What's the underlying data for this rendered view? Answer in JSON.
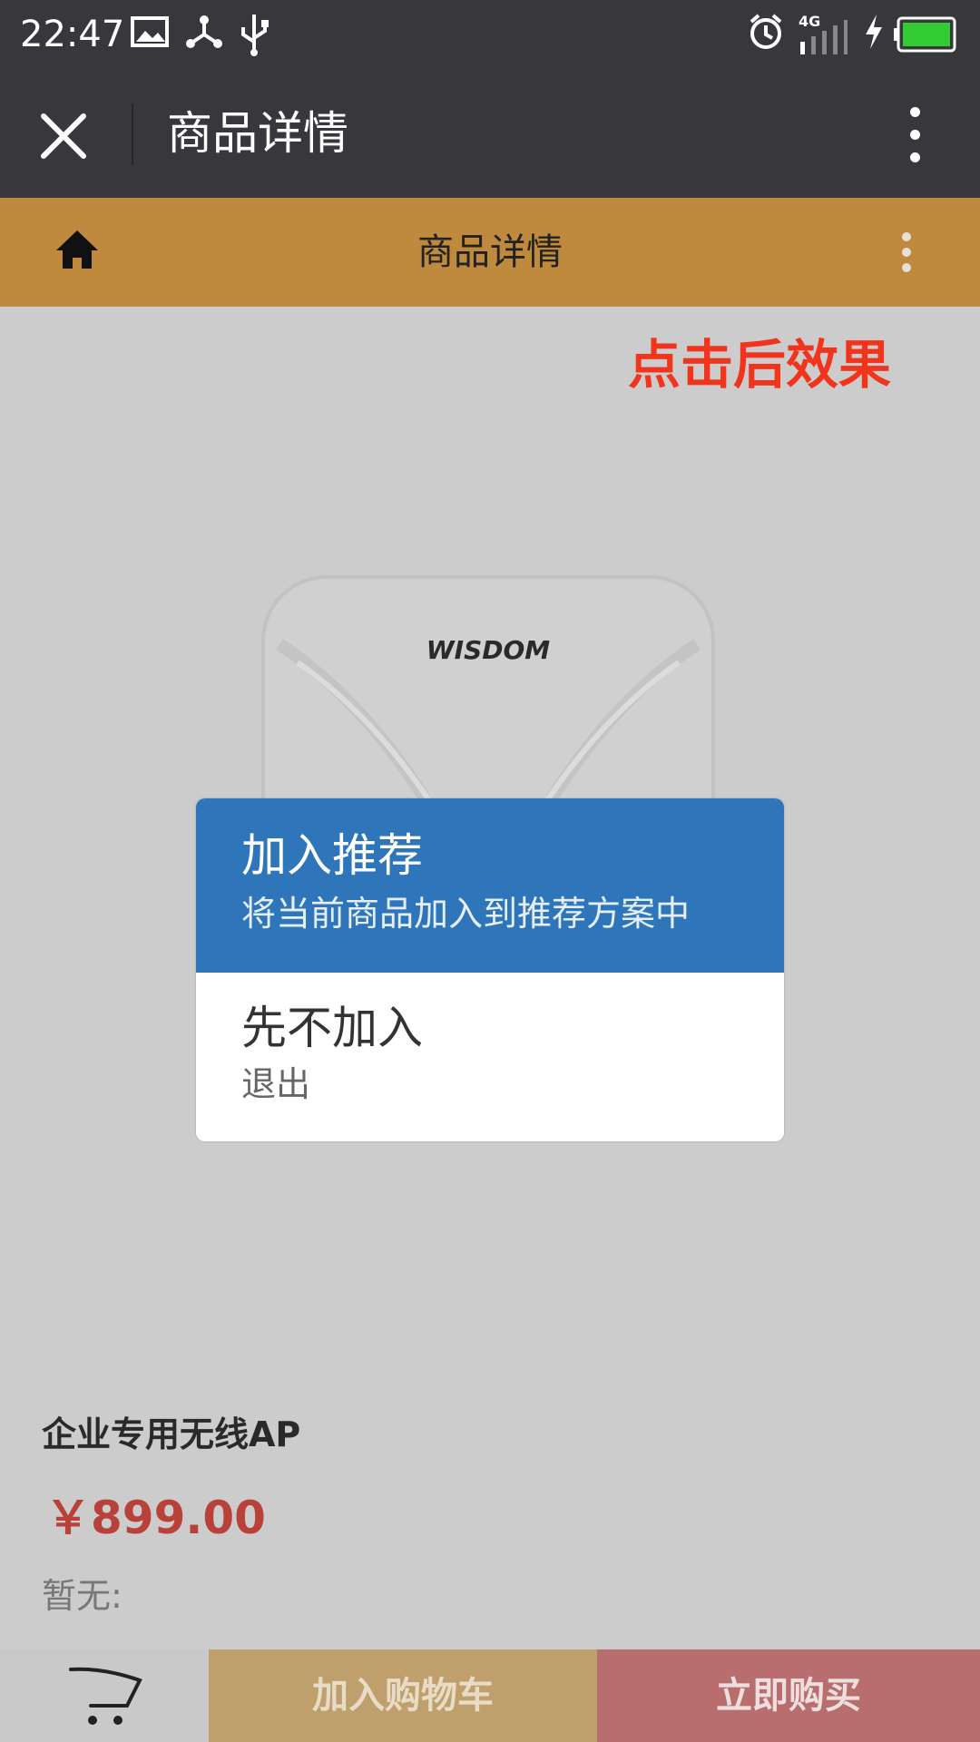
{
  "status_bar": {
    "time": "22:47",
    "network": "4G",
    "icons": [
      "image-icon",
      "share-icon",
      "usb-icon",
      "alarm-icon",
      "signal-icon",
      "charging-icon",
      "battery-icon"
    ],
    "battery_color": "#33cc33"
  },
  "title_bar": {
    "title": "商品详情",
    "close_icon": "close-icon",
    "more_icon": "more-vertical-icon"
  },
  "app_header": {
    "title": "商品详情",
    "home_icon": "home-icon",
    "more_icon": "more-vertical-icon",
    "color": "#c08a3e"
  },
  "annotation": "点击后效果",
  "product": {
    "image_brand": "WISDOM",
    "name": "企业专用无线AP",
    "price": "￥899.00",
    "note": "暂无:"
  },
  "dialog": {
    "options": [
      {
        "title": "加入推荐",
        "subtitle": "将当前商品加入到推荐方案中",
        "color": "#2e76b9"
      },
      {
        "title": "先不加入",
        "subtitle": "退出"
      }
    ]
  },
  "bottom_bar": {
    "cart_icon": "cart-icon",
    "add_to_cart": "加入购物车",
    "buy_now": "立即购买"
  }
}
